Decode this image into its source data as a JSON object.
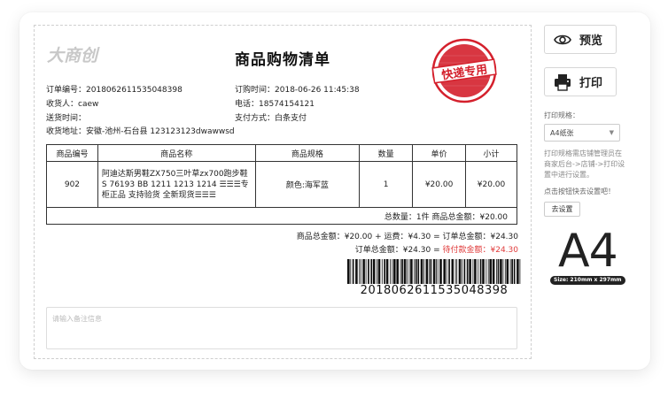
{
  "brand": {
    "logo_text": "大商创"
  },
  "sheet": {
    "title": "商品购物清单",
    "stamp_text": "快递专用"
  },
  "order": {
    "order_no_label": "订单编号：",
    "order_no": "2018062611535048398",
    "buy_time_label": "订购时间：",
    "buy_time": "2018-06-26 11:45:38",
    "consignee_label": "收货人：",
    "consignee": "caew",
    "phone_label": "电话：",
    "phone": "18574154121",
    "delivery_time_label": "送货时间：",
    "delivery_time": "",
    "pay_label": "支付方式：",
    "pay": "白条支付",
    "address_label": "收货地址：",
    "address": "安徽-池州-石台县 123123123dwawwsd"
  },
  "table": {
    "headers": [
      "商品编号",
      "商品名称",
      "商品规格",
      "数量",
      "单价",
      "小计"
    ],
    "rows": [
      {
        "id": "902",
        "name": "阿迪达斯男鞋ZX750三叶草zx700跑步鞋S 76193 BB 1211 1213 1214 ☰☰☰专柜正品 支持验货 全新现货☰☰☰",
        "spec": "颜色:海军蓝",
        "qty": "1",
        "price": "¥20.00",
        "subtotal": "¥20.00"
      }
    ],
    "totals": "总数量：1件   商品总金额：¥20.00"
  },
  "summary": {
    "line1": "商品总金额：¥20.00 + 运费：¥4.30 = 订单总金额：¥24.30",
    "line2_prefix": "订单总金额：¥24.30 = ",
    "line2_due": "待付款金额：¥24.30"
  },
  "barcode": {
    "number": "2018062611535048398"
  },
  "remark": {
    "placeholder": "请输入备注信息"
  },
  "sidebar": {
    "preview_label": "预览",
    "print_label": "打印",
    "spec_label": "打印规格：",
    "paper_selected": "A4纸张",
    "hint_lines": [
      "打印规格需店铺管理员在",
      "商家后台->店铺->打印设",
      "置中进行设置。"
    ],
    "urge_text": "点击按钮快去设置吧！",
    "goto_button": "去设置",
    "paper_big": "A4",
    "paper_size": "Size: 210mm x 297mm"
  },
  "colors": {
    "accent_red": "#e03c3c",
    "stamp_red": "#d4202c"
  }
}
